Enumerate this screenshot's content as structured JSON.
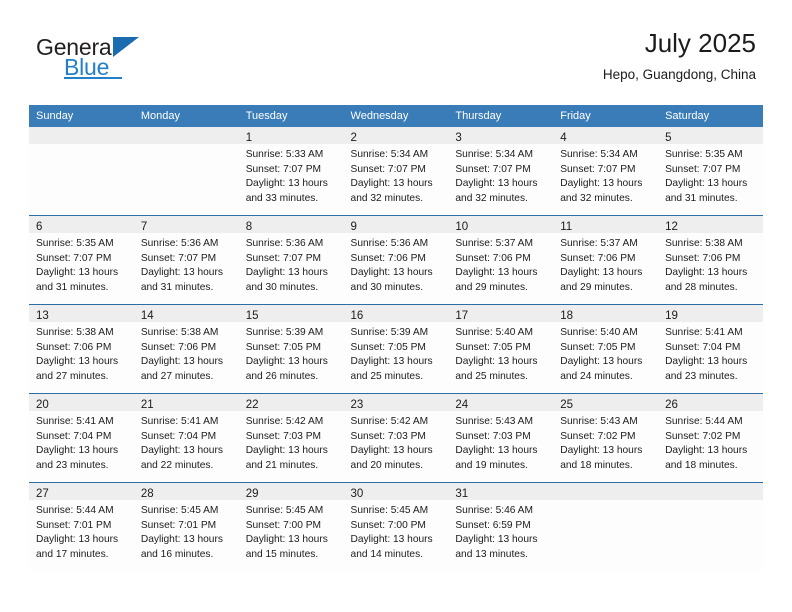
{
  "logo": {
    "word_1": "General",
    "word_2": "Blue",
    "triangle_color": "#1a6bb0",
    "blue_color": "#2380c8"
  },
  "header": {
    "title": "July 2025",
    "subtitle": "Hepo, Guangdong, China"
  },
  "theme": {
    "header_row_bg": "#3a7cb8",
    "week_divider": "#2e6da4",
    "daynum_band_bg": "#eeeeee",
    "cell_bg": "#fdfdfd",
    "text": "#1c1c1c"
  },
  "weekdays": [
    "Sunday",
    "Monday",
    "Tuesday",
    "Wednesday",
    "Thursday",
    "Friday",
    "Saturday"
  ],
  "labels": {
    "sunrise_prefix": "Sunrise:",
    "sunset_prefix": "Sunset:",
    "daylight_prefix": "Daylight:"
  },
  "weeks": [
    [
      {
        "day": "",
        "sunrise": "",
        "sunset": "",
        "daylight_1": "",
        "daylight_2": ""
      },
      {
        "day": "",
        "sunrise": "",
        "sunset": "",
        "daylight_1": "",
        "daylight_2": ""
      },
      {
        "day": "1",
        "sunrise": "Sunrise: 5:33 AM",
        "sunset": "Sunset: 7:07 PM",
        "daylight_1": "Daylight: 13 hours",
        "daylight_2": "and 33 minutes."
      },
      {
        "day": "2",
        "sunrise": "Sunrise: 5:34 AM",
        "sunset": "Sunset: 7:07 PM",
        "daylight_1": "Daylight: 13 hours",
        "daylight_2": "and 32 minutes."
      },
      {
        "day": "3",
        "sunrise": "Sunrise: 5:34 AM",
        "sunset": "Sunset: 7:07 PM",
        "daylight_1": "Daylight: 13 hours",
        "daylight_2": "and 32 minutes."
      },
      {
        "day": "4",
        "sunrise": "Sunrise: 5:34 AM",
        "sunset": "Sunset: 7:07 PM",
        "daylight_1": "Daylight: 13 hours",
        "daylight_2": "and 32 minutes."
      },
      {
        "day": "5",
        "sunrise": "Sunrise: 5:35 AM",
        "sunset": "Sunset: 7:07 PM",
        "daylight_1": "Daylight: 13 hours",
        "daylight_2": "and 31 minutes."
      }
    ],
    [
      {
        "day": "6",
        "sunrise": "Sunrise: 5:35 AM",
        "sunset": "Sunset: 7:07 PM",
        "daylight_1": "Daylight: 13 hours",
        "daylight_2": "and 31 minutes."
      },
      {
        "day": "7",
        "sunrise": "Sunrise: 5:36 AM",
        "sunset": "Sunset: 7:07 PM",
        "daylight_1": "Daylight: 13 hours",
        "daylight_2": "and 31 minutes."
      },
      {
        "day": "8",
        "sunrise": "Sunrise: 5:36 AM",
        "sunset": "Sunset: 7:07 PM",
        "daylight_1": "Daylight: 13 hours",
        "daylight_2": "and 30 minutes."
      },
      {
        "day": "9",
        "sunrise": "Sunrise: 5:36 AM",
        "sunset": "Sunset: 7:06 PM",
        "daylight_1": "Daylight: 13 hours",
        "daylight_2": "and 30 minutes."
      },
      {
        "day": "10",
        "sunrise": "Sunrise: 5:37 AM",
        "sunset": "Sunset: 7:06 PM",
        "daylight_1": "Daylight: 13 hours",
        "daylight_2": "and 29 minutes."
      },
      {
        "day": "11",
        "sunrise": "Sunrise: 5:37 AM",
        "sunset": "Sunset: 7:06 PM",
        "daylight_1": "Daylight: 13 hours",
        "daylight_2": "and 29 minutes."
      },
      {
        "day": "12",
        "sunrise": "Sunrise: 5:38 AM",
        "sunset": "Sunset: 7:06 PM",
        "daylight_1": "Daylight: 13 hours",
        "daylight_2": "and 28 minutes."
      }
    ],
    [
      {
        "day": "13",
        "sunrise": "Sunrise: 5:38 AM",
        "sunset": "Sunset: 7:06 PM",
        "daylight_1": "Daylight: 13 hours",
        "daylight_2": "and 27 minutes."
      },
      {
        "day": "14",
        "sunrise": "Sunrise: 5:38 AM",
        "sunset": "Sunset: 7:06 PM",
        "daylight_1": "Daylight: 13 hours",
        "daylight_2": "and 27 minutes."
      },
      {
        "day": "15",
        "sunrise": "Sunrise: 5:39 AM",
        "sunset": "Sunset: 7:05 PM",
        "daylight_1": "Daylight: 13 hours",
        "daylight_2": "and 26 minutes."
      },
      {
        "day": "16",
        "sunrise": "Sunrise: 5:39 AM",
        "sunset": "Sunset: 7:05 PM",
        "daylight_1": "Daylight: 13 hours",
        "daylight_2": "and 25 minutes."
      },
      {
        "day": "17",
        "sunrise": "Sunrise: 5:40 AM",
        "sunset": "Sunset: 7:05 PM",
        "daylight_1": "Daylight: 13 hours",
        "daylight_2": "and 25 minutes."
      },
      {
        "day": "18",
        "sunrise": "Sunrise: 5:40 AM",
        "sunset": "Sunset: 7:05 PM",
        "daylight_1": "Daylight: 13 hours",
        "daylight_2": "and 24 minutes."
      },
      {
        "day": "19",
        "sunrise": "Sunrise: 5:41 AM",
        "sunset": "Sunset: 7:04 PM",
        "daylight_1": "Daylight: 13 hours",
        "daylight_2": "and 23 minutes."
      }
    ],
    [
      {
        "day": "20",
        "sunrise": "Sunrise: 5:41 AM",
        "sunset": "Sunset: 7:04 PM",
        "daylight_1": "Daylight: 13 hours",
        "daylight_2": "and 23 minutes."
      },
      {
        "day": "21",
        "sunrise": "Sunrise: 5:41 AM",
        "sunset": "Sunset: 7:04 PM",
        "daylight_1": "Daylight: 13 hours",
        "daylight_2": "and 22 minutes."
      },
      {
        "day": "22",
        "sunrise": "Sunrise: 5:42 AM",
        "sunset": "Sunset: 7:03 PM",
        "daylight_1": "Daylight: 13 hours",
        "daylight_2": "and 21 minutes."
      },
      {
        "day": "23",
        "sunrise": "Sunrise: 5:42 AM",
        "sunset": "Sunset: 7:03 PM",
        "daylight_1": "Daylight: 13 hours",
        "daylight_2": "and 20 minutes."
      },
      {
        "day": "24",
        "sunrise": "Sunrise: 5:43 AM",
        "sunset": "Sunset: 7:03 PM",
        "daylight_1": "Daylight: 13 hours",
        "daylight_2": "and 19 minutes."
      },
      {
        "day": "25",
        "sunrise": "Sunrise: 5:43 AM",
        "sunset": "Sunset: 7:02 PM",
        "daylight_1": "Daylight: 13 hours",
        "daylight_2": "and 18 minutes."
      },
      {
        "day": "26",
        "sunrise": "Sunrise: 5:44 AM",
        "sunset": "Sunset: 7:02 PM",
        "daylight_1": "Daylight: 13 hours",
        "daylight_2": "and 18 minutes."
      }
    ],
    [
      {
        "day": "27",
        "sunrise": "Sunrise: 5:44 AM",
        "sunset": "Sunset: 7:01 PM",
        "daylight_1": "Daylight: 13 hours",
        "daylight_2": "and 17 minutes."
      },
      {
        "day": "28",
        "sunrise": "Sunrise: 5:45 AM",
        "sunset": "Sunset: 7:01 PM",
        "daylight_1": "Daylight: 13 hours",
        "daylight_2": "and 16 minutes."
      },
      {
        "day": "29",
        "sunrise": "Sunrise: 5:45 AM",
        "sunset": "Sunset: 7:00 PM",
        "daylight_1": "Daylight: 13 hours",
        "daylight_2": "and 15 minutes."
      },
      {
        "day": "30",
        "sunrise": "Sunrise: 5:45 AM",
        "sunset": "Sunset: 7:00 PM",
        "daylight_1": "Daylight: 13 hours",
        "daylight_2": "and 14 minutes."
      },
      {
        "day": "31",
        "sunrise": "Sunrise: 5:46 AM",
        "sunset": "Sunset: 6:59 PM",
        "daylight_1": "Daylight: 13 hours",
        "daylight_2": "and 13 minutes."
      },
      {
        "day": "",
        "sunrise": "",
        "sunset": "",
        "daylight_1": "",
        "daylight_2": ""
      },
      {
        "day": "",
        "sunrise": "",
        "sunset": "",
        "daylight_1": "",
        "daylight_2": ""
      }
    ]
  ]
}
